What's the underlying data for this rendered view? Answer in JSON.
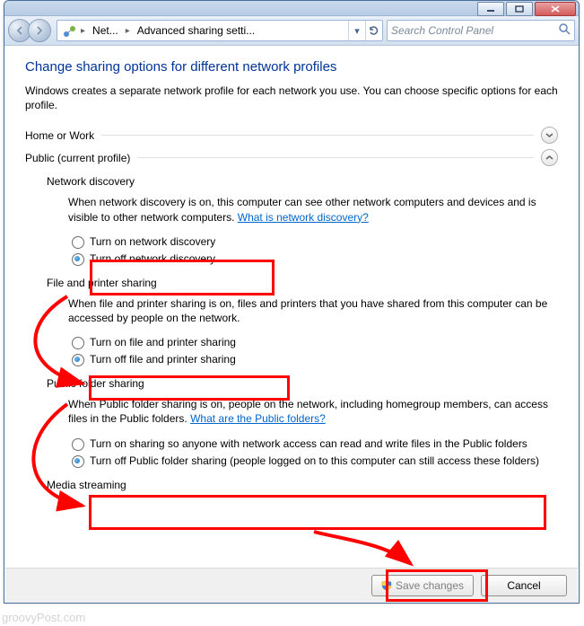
{
  "titlebar": {
    "min": "—",
    "max": "▢",
    "close": "✕"
  },
  "nav": {
    "crumb1": "Net...",
    "crumb2": "Advanced sharing setti...",
    "search_placeholder": "Search Control Panel"
  },
  "page": {
    "title": "Change sharing options for different network profiles",
    "intro": "Windows creates a separate network profile for each network you use. You can choose specific options for each profile."
  },
  "sections": {
    "home": {
      "label": "Home or Work"
    },
    "public": {
      "label": "Public (current profile)",
      "netdisc": {
        "title": "Network discovery",
        "desc": "When network discovery is on, this computer can see other network computers and devices and is visible to other network computers. ",
        "link": "What is network discovery?",
        "opt_on": "Turn on network discovery",
        "opt_off": "Turn off network discovery"
      },
      "fps": {
        "title": "File and printer sharing",
        "desc": "When file and printer sharing is on, files and printers that you have shared from this computer can be accessed by people on the network.",
        "opt_on": "Turn on file and printer sharing",
        "opt_off": "Turn off file and printer sharing"
      },
      "pfs": {
        "title": "Public folder sharing",
        "desc": "When Public folder sharing is on, people on the network, including homegroup members, can access files in the Public folders. ",
        "link": "What are the Public folders?",
        "opt_on": "Turn on sharing so anyone with network access can read and write files in the Public folders",
        "opt_off": "Turn off Public folder sharing (people logged on to this computer can still access these folders)"
      },
      "media": {
        "title": "Media streaming"
      }
    }
  },
  "buttons": {
    "save": "Save changes",
    "cancel": "Cancel"
  },
  "watermark": "groovyPost.com"
}
